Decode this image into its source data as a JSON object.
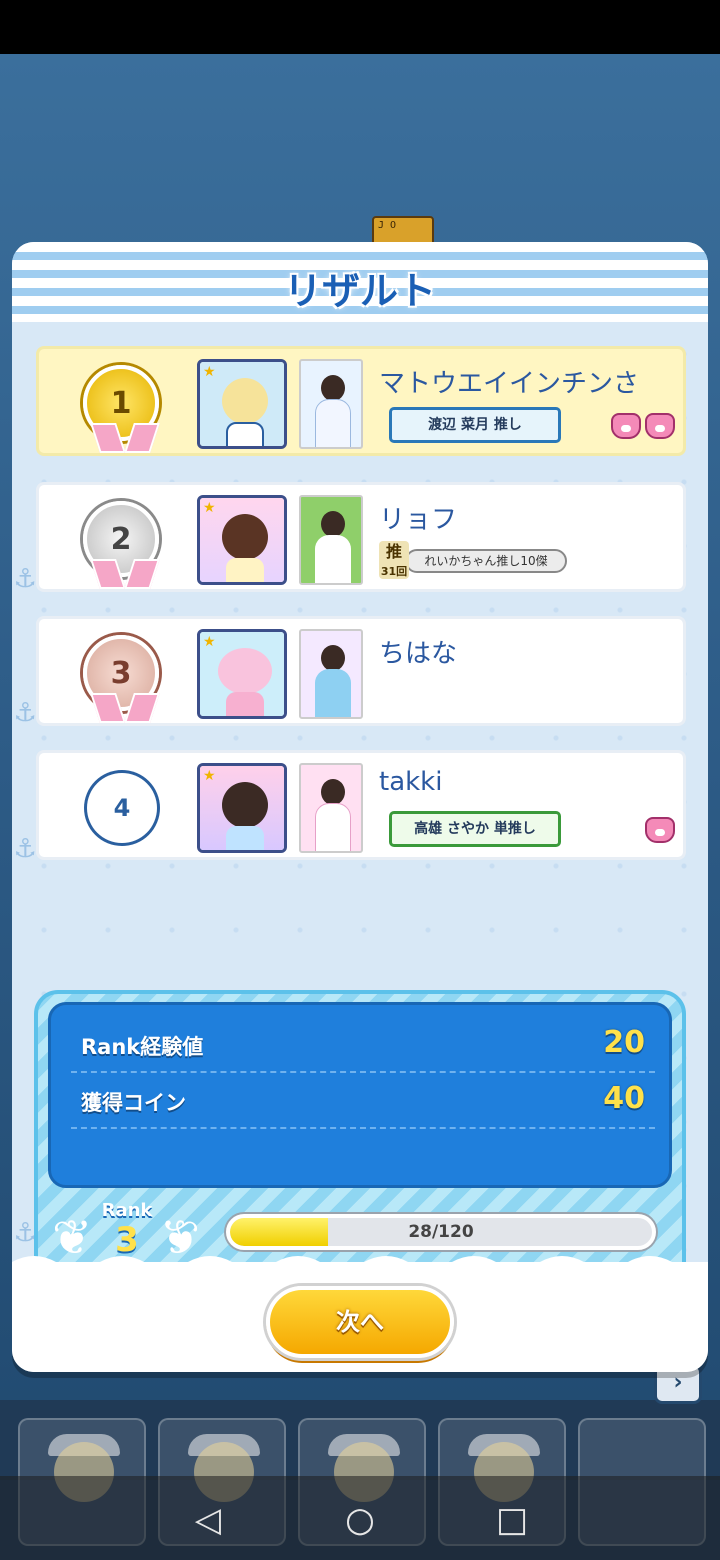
{
  "modal": {
    "title": "リザルト",
    "next_label": "次へ"
  },
  "players": [
    {
      "rank": "1",
      "name": "マトウエイインチンさ",
      "oshi": "渡辺 菜月 推し",
      "pig_count": 2
    },
    {
      "rank": "2",
      "name": "リョフ",
      "oshi_stamp": "推",
      "oshi_count": "31回",
      "oshi_title": "れいかちゃん推し10傑"
    },
    {
      "rank": "3",
      "name": "ちはな"
    },
    {
      "rank": "4",
      "name": "takki",
      "oshi": "高雄 さやか 単推し",
      "pig_count": 1
    }
  ],
  "stats": {
    "rank_exp_label": "Rank経験値",
    "rank_exp_value": "20",
    "coin_label": "獲得コイン",
    "coin_value": "40",
    "rank_caption": "Rank",
    "rank_number": "3",
    "exp_text": "28/120",
    "exp_current": 28,
    "exp_max": 120
  },
  "background": {
    "card_label": "J O",
    "side_arrow": "›"
  },
  "navbar": {
    "back": "◁",
    "home": "○",
    "recents": "□"
  },
  "colors": {
    "title": "#1a5fb5",
    "stats_panel": "#1f7fdc",
    "value_yellow": "#ffe14a",
    "next_button": "#f5b400"
  }
}
